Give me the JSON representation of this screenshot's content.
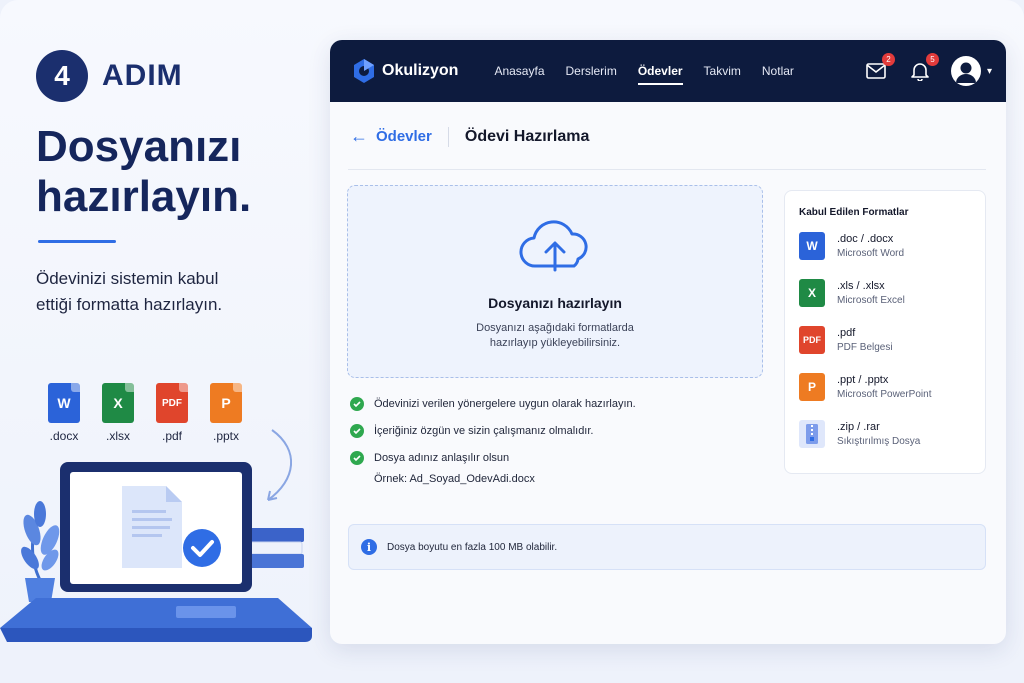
{
  "step": {
    "number": "4",
    "label": "ADIM"
  },
  "hero": {
    "title": "Dosyanızı hazırlayın.",
    "description": "Ödevinizi sistemin kabul ettiği formatta hazırlayın."
  },
  "file_icons": [
    {
      "letter": "W",
      "label": ".docx",
      "color": "#2b63d9",
      "icon": "word-file-icon"
    },
    {
      "letter": "X",
      "label": ".xlsx",
      "color": "#1f8a45",
      "icon": "excel-file-icon"
    },
    {
      "letter": "PDF",
      "label": ".pdf",
      "color": "#e0452c",
      "icon": "pdf-file-icon"
    },
    {
      "letter": "P",
      "label": ".pptx",
      "color": "#ee7b22",
      "icon": "powerpoint-file-icon"
    }
  ],
  "app": {
    "brand": "Okulizyon",
    "nav": [
      {
        "label": "Anasayfa",
        "active": false
      },
      {
        "label": "Derslerim",
        "active": false
      },
      {
        "label": "Ödevler",
        "active": true
      },
      {
        "label": "Takvim",
        "active": false
      },
      {
        "label": "Notlar",
        "active": false
      }
    ],
    "mail_badge": "2",
    "notif_badge": "5",
    "breadcrumb": {
      "back": "Ödevler",
      "title": "Ödevi Hazırlama"
    },
    "dropzone": {
      "title": "Dosyanızı hazırlayın",
      "description": "Dosyanızı aşağıdaki formatlarda hazırlayıp yükleyebilirsiniz."
    },
    "checklist": [
      "Ödevinizi verilen yönergelere uygun olarak hazırlayın.",
      "İçeriğiniz özgün ve sizin çalışmanız olmalıdır.",
      "Dosya adınız anlaşılır olsun"
    ],
    "example": "Örnek:  Ad_Soyad_OdevAdi.docx",
    "formats": {
      "title": "Kabul Edilen Formatlar",
      "items": [
        {
          "letter": "W",
          "ext": ".doc / .docx",
          "name": "Microsoft Word",
          "color": "#2b63d9",
          "icon": "word-file-icon"
        },
        {
          "letter": "X",
          "ext": ".xls / .xlsx",
          "name": "Microsoft Excel",
          "color": "#1f8a45",
          "icon": "excel-file-icon"
        },
        {
          "letter": "PDF",
          "ext": ".pdf",
          "name": "PDF Belgesi",
          "color": "#e0452c",
          "icon": "pdf-file-icon"
        },
        {
          "letter": "P",
          "ext": ".ppt / .pptx",
          "name": "Microsoft PowerPoint",
          "color": "#ee7b22",
          "icon": "powerpoint-file-icon"
        },
        {
          "letter": "",
          "ext": ".zip / .rar",
          "name": "Sıkıştırılmış Dosya",
          "color": "#5b7fe0",
          "icon": "zip-file-icon"
        }
      ]
    },
    "info": "Dosya boyutu en fazla 100 MB olabilir."
  },
  "colors": {
    "navy": "#0d1b3e",
    "accent": "#2f6de5",
    "success": "#2fa84f"
  }
}
